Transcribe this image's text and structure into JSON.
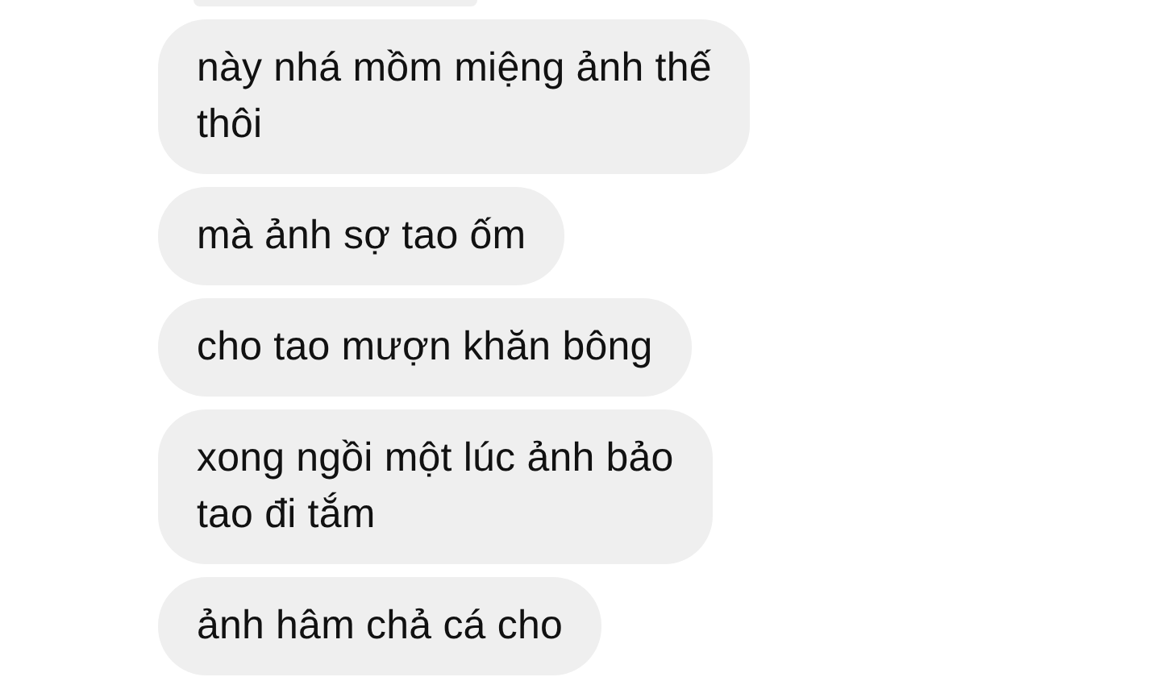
{
  "messages": [
    {
      "lines": [
        "này nhá mồm miệng ảnh thế",
        "thôi"
      ]
    },
    {
      "lines": [
        "mà ảnh sợ tao ốm"
      ]
    },
    {
      "lines": [
        "cho tao mượn khăn bông"
      ]
    },
    {
      "lines": [
        "xong ngồi một lúc ảnh bảo",
        "tao đi tắm"
      ]
    },
    {
      "lines": [
        "ảnh hâm chả cá cho"
      ]
    }
  ]
}
